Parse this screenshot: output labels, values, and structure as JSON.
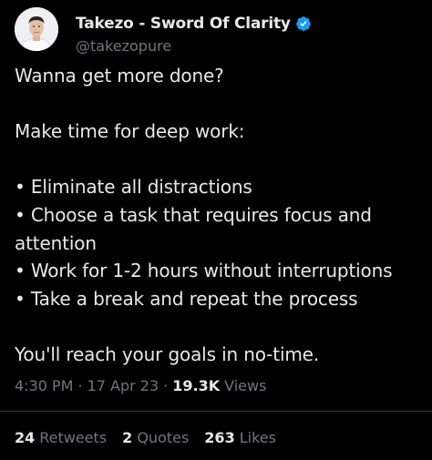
{
  "author": {
    "display_name": "Takezo - Sword Of Clarity",
    "handle": "@takezopure",
    "verified_icon": "verified-badge-icon",
    "verified_color": "#1d9bf0"
  },
  "tweet": {
    "lines": [
      "Wanna get more done?",
      "",
      "Make time for deep work:",
      "",
      "• Eliminate all distractions",
      "• Choose a task that requires focus and",
      "attention",
      "• Work for 1-2 hours without interruptions",
      "• Take a break and repeat the process",
      "",
      "You'll reach your goals in no-time."
    ]
  },
  "meta": {
    "time": "4:30 PM",
    "separator": "·",
    "date": "17 Apr 23",
    "views_count": "19.3K",
    "views_label": "Views"
  },
  "stats": {
    "retweets_count": "24",
    "retweets_label": "Retweets",
    "quotes_count": "2",
    "quotes_label": "Quotes",
    "likes_count": "263",
    "likes_label": "Likes"
  },
  "colors": {
    "background": "#000000",
    "text_primary": "#e7e9ea",
    "text_secondary": "#71767b",
    "divider": "#2f3336"
  }
}
